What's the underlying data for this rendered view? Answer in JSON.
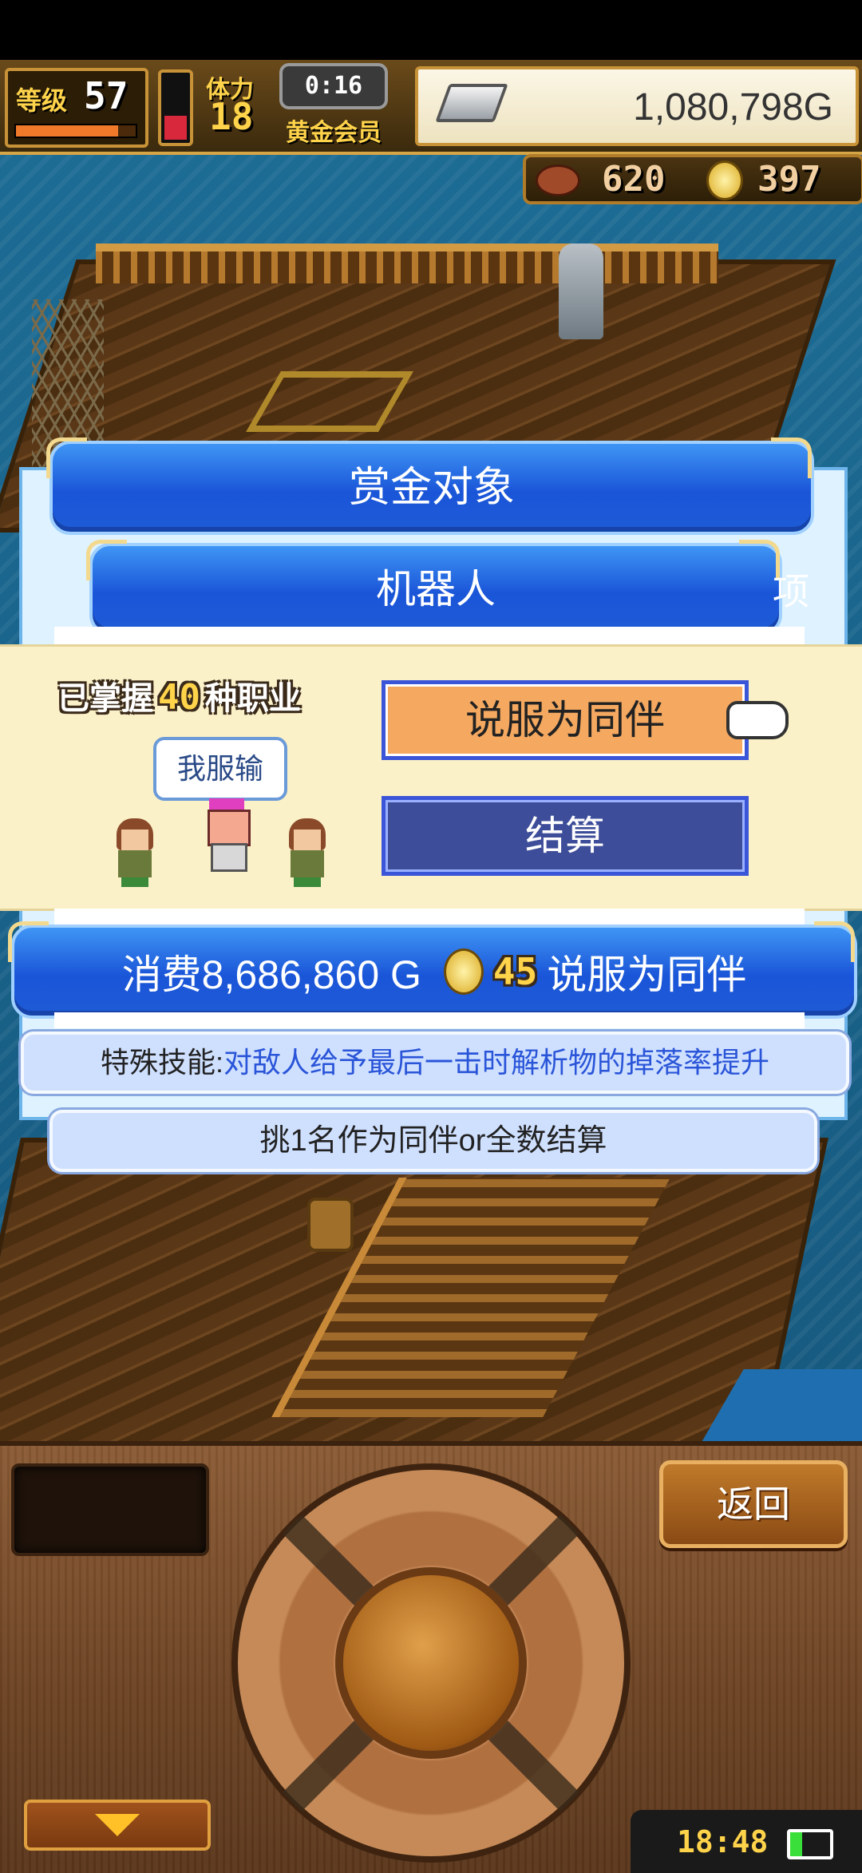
{
  "hud": {
    "level_label": "等级",
    "level_value": "57",
    "stamina_label": "体力",
    "stamina_value": "18",
    "timer": "0:16",
    "membership": "黄金会员",
    "gold": "1,080,798G",
    "food": "620",
    "medals": "397"
  },
  "dialog": {
    "title": "赏金对象",
    "target_name": "机器人",
    "side_text": "项",
    "cost_text": "消费8,686,860 G",
    "medal_cost": "45",
    "cost_suffix": "说服为同伴",
    "skill_label": "特殊技能:",
    "skill_text": "对敌人给予最后一击时解析物的掉落率提升",
    "instruction": "挑1名作为同伴or全数结算"
  },
  "panel": {
    "mastered_prefix": "已掌握",
    "mastered_count": "40",
    "mastered_suffix": "种职业",
    "speech": "我服输",
    "persuade_button": "说服为同伴",
    "settle_button": "结算"
  },
  "controls": {
    "back_button": "返回",
    "clock": "18:48"
  },
  "colors": {
    "accent_blue": "#1a55d8",
    "persuade_orange": "#f4a860",
    "settle_navy": "#3d4d99",
    "panel_cream": "#fbf1c8",
    "gold_text": "#ffd34a"
  },
  "icons": [
    "silver-ingot-icon",
    "meat-icon",
    "medal-coin-icon",
    "pointing-hand-icon",
    "down-arrow-icon",
    "battery-icon"
  ]
}
